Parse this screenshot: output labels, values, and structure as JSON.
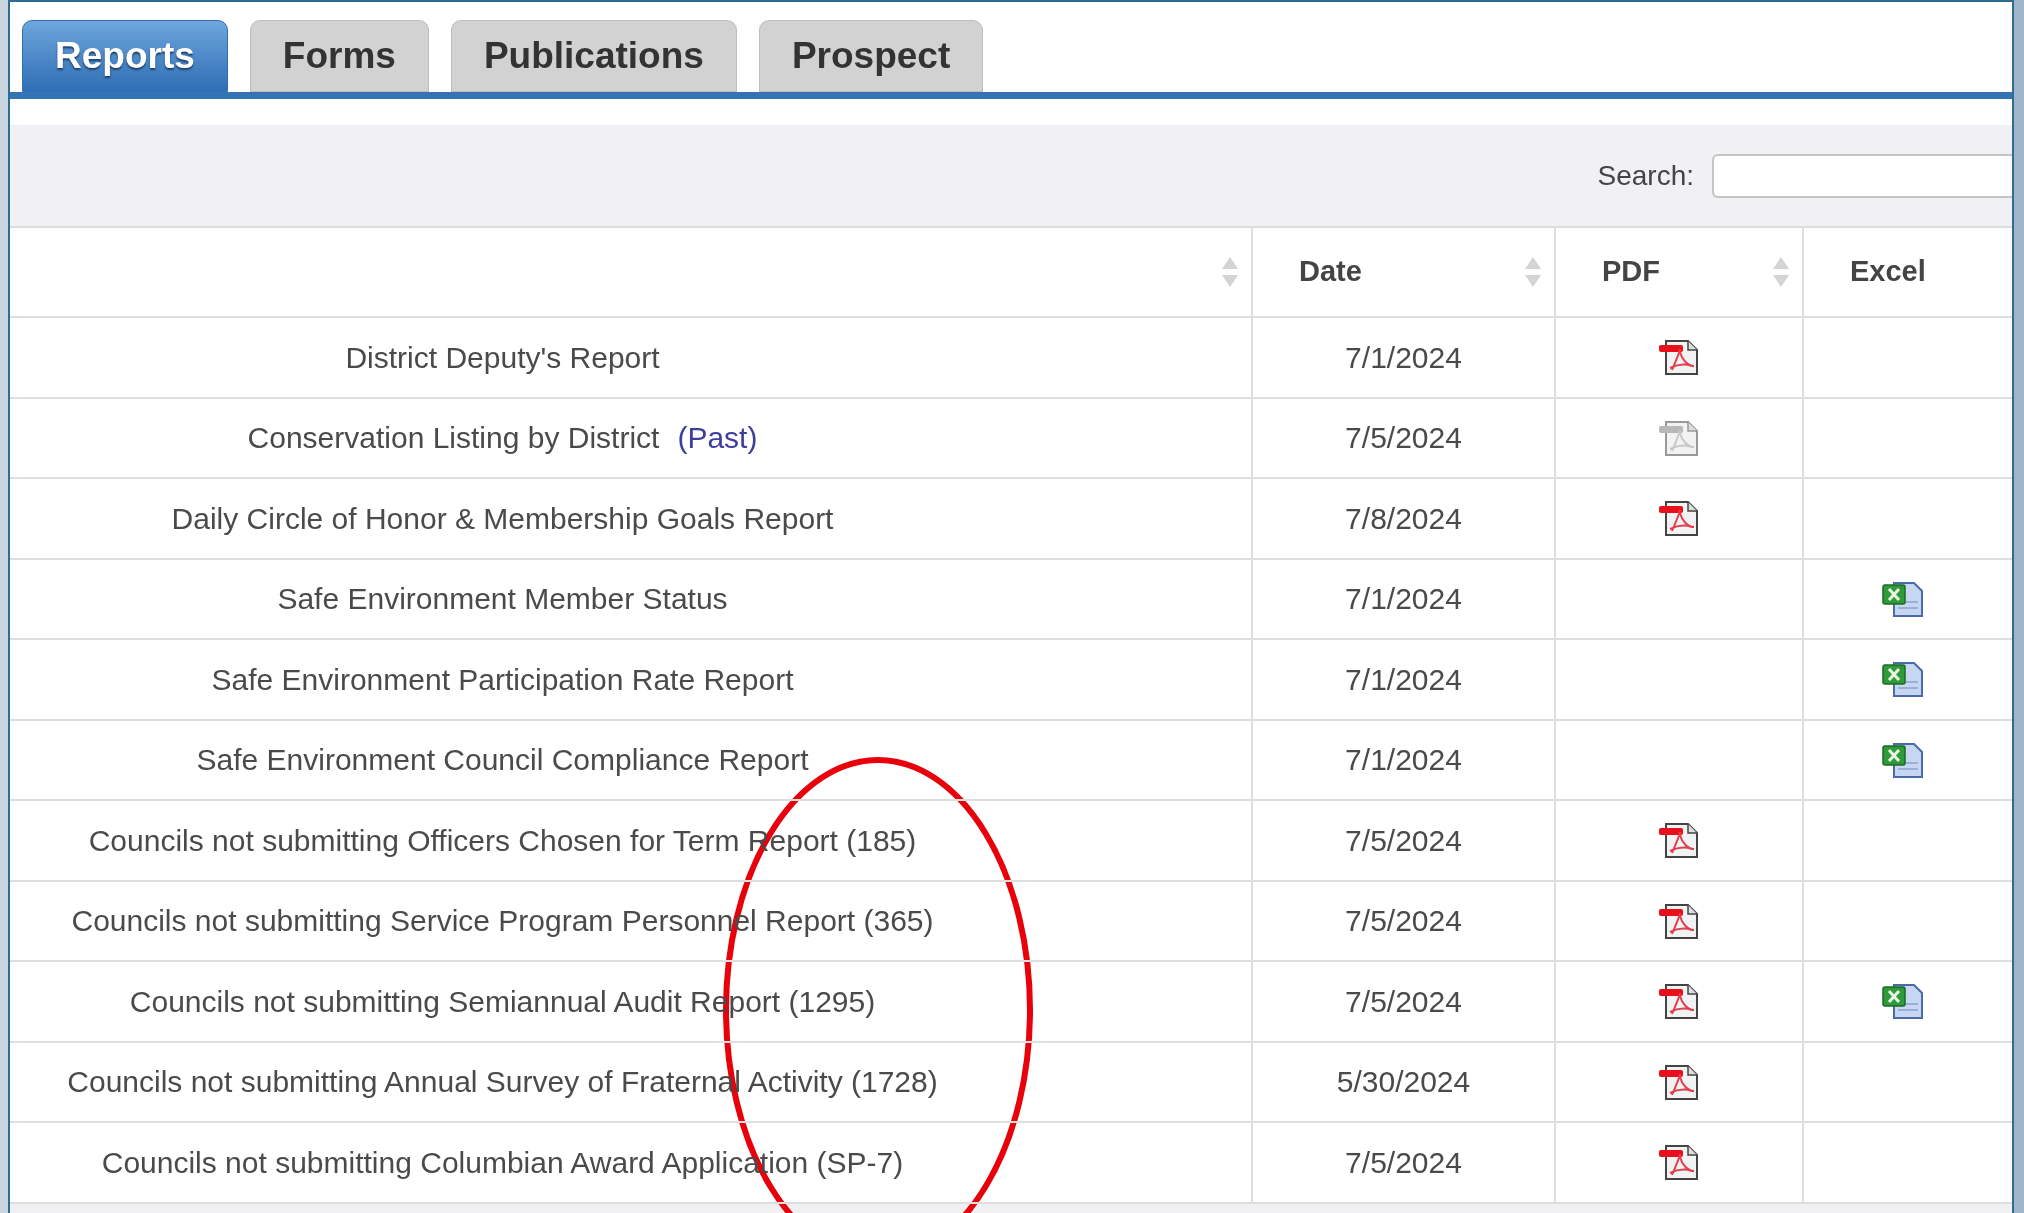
{
  "tabs": [
    {
      "label": "Reports",
      "selected": true
    },
    {
      "label": "Forms",
      "selected": false
    },
    {
      "label": "Publications",
      "selected": false
    },
    {
      "label": "Prospect",
      "selected": false
    }
  ],
  "search": {
    "label": "Search:"
  },
  "table": {
    "columns": [
      {
        "sortable": true
      },
      {
        "label": "Date",
        "sortable": true
      },
      {
        "label": "PDF",
        "sortable": true
      },
      {
        "label": "Excel",
        "sortable": false
      }
    ],
    "rows": [
      {
        "title": "District Deputy's Report",
        "date": "7/1/2024",
        "pdf": {
          "disabled": false
        },
        "excel": false
      },
      {
        "title": "Conservation Listing by District",
        "link": "(Past)",
        "date": "7/5/2024",
        "pdf": {
          "disabled": true
        },
        "excel": false
      },
      {
        "title": "Daily Circle of Honor & Membership Goals Report",
        "date": "7/8/2024",
        "pdf": {
          "disabled": false
        },
        "excel": false
      },
      {
        "title": "Safe Environment Member Status",
        "date": "7/1/2024",
        "excel": true
      },
      {
        "title": "Safe Environment Participation Rate Report",
        "date": "7/1/2024",
        "excel": true
      },
      {
        "title": "Safe Environment Council Compliance Report",
        "date": "7/1/2024",
        "excel": true
      },
      {
        "title": "Councils not submitting Officers Chosen for Term Report (185)",
        "date": "7/5/2024",
        "pdf": {
          "disabled": false
        },
        "excel": false
      },
      {
        "title": "Councils not submitting Service Program Personnel Report (365)",
        "date": "7/5/2024",
        "pdf": {
          "disabled": false
        },
        "excel": false
      },
      {
        "title": "Councils not submitting Semiannual Audit Report (1295)",
        "date": "7/5/2024",
        "pdf": {
          "disabled": false
        },
        "excel": true
      },
      {
        "title": "Councils not submitting Annual Survey of Fraternal Activity (1728)",
        "date": "5/30/2024",
        "pdf": {
          "disabled": false
        },
        "excel": false
      },
      {
        "title": "Councils not submitting Columbian Award Application (SP-7)",
        "date": "7/5/2024",
        "pdf": {
          "disabled": false
        },
        "excel": false
      }
    ]
  },
  "annotation": {
    "kind": "ellipse"
  }
}
